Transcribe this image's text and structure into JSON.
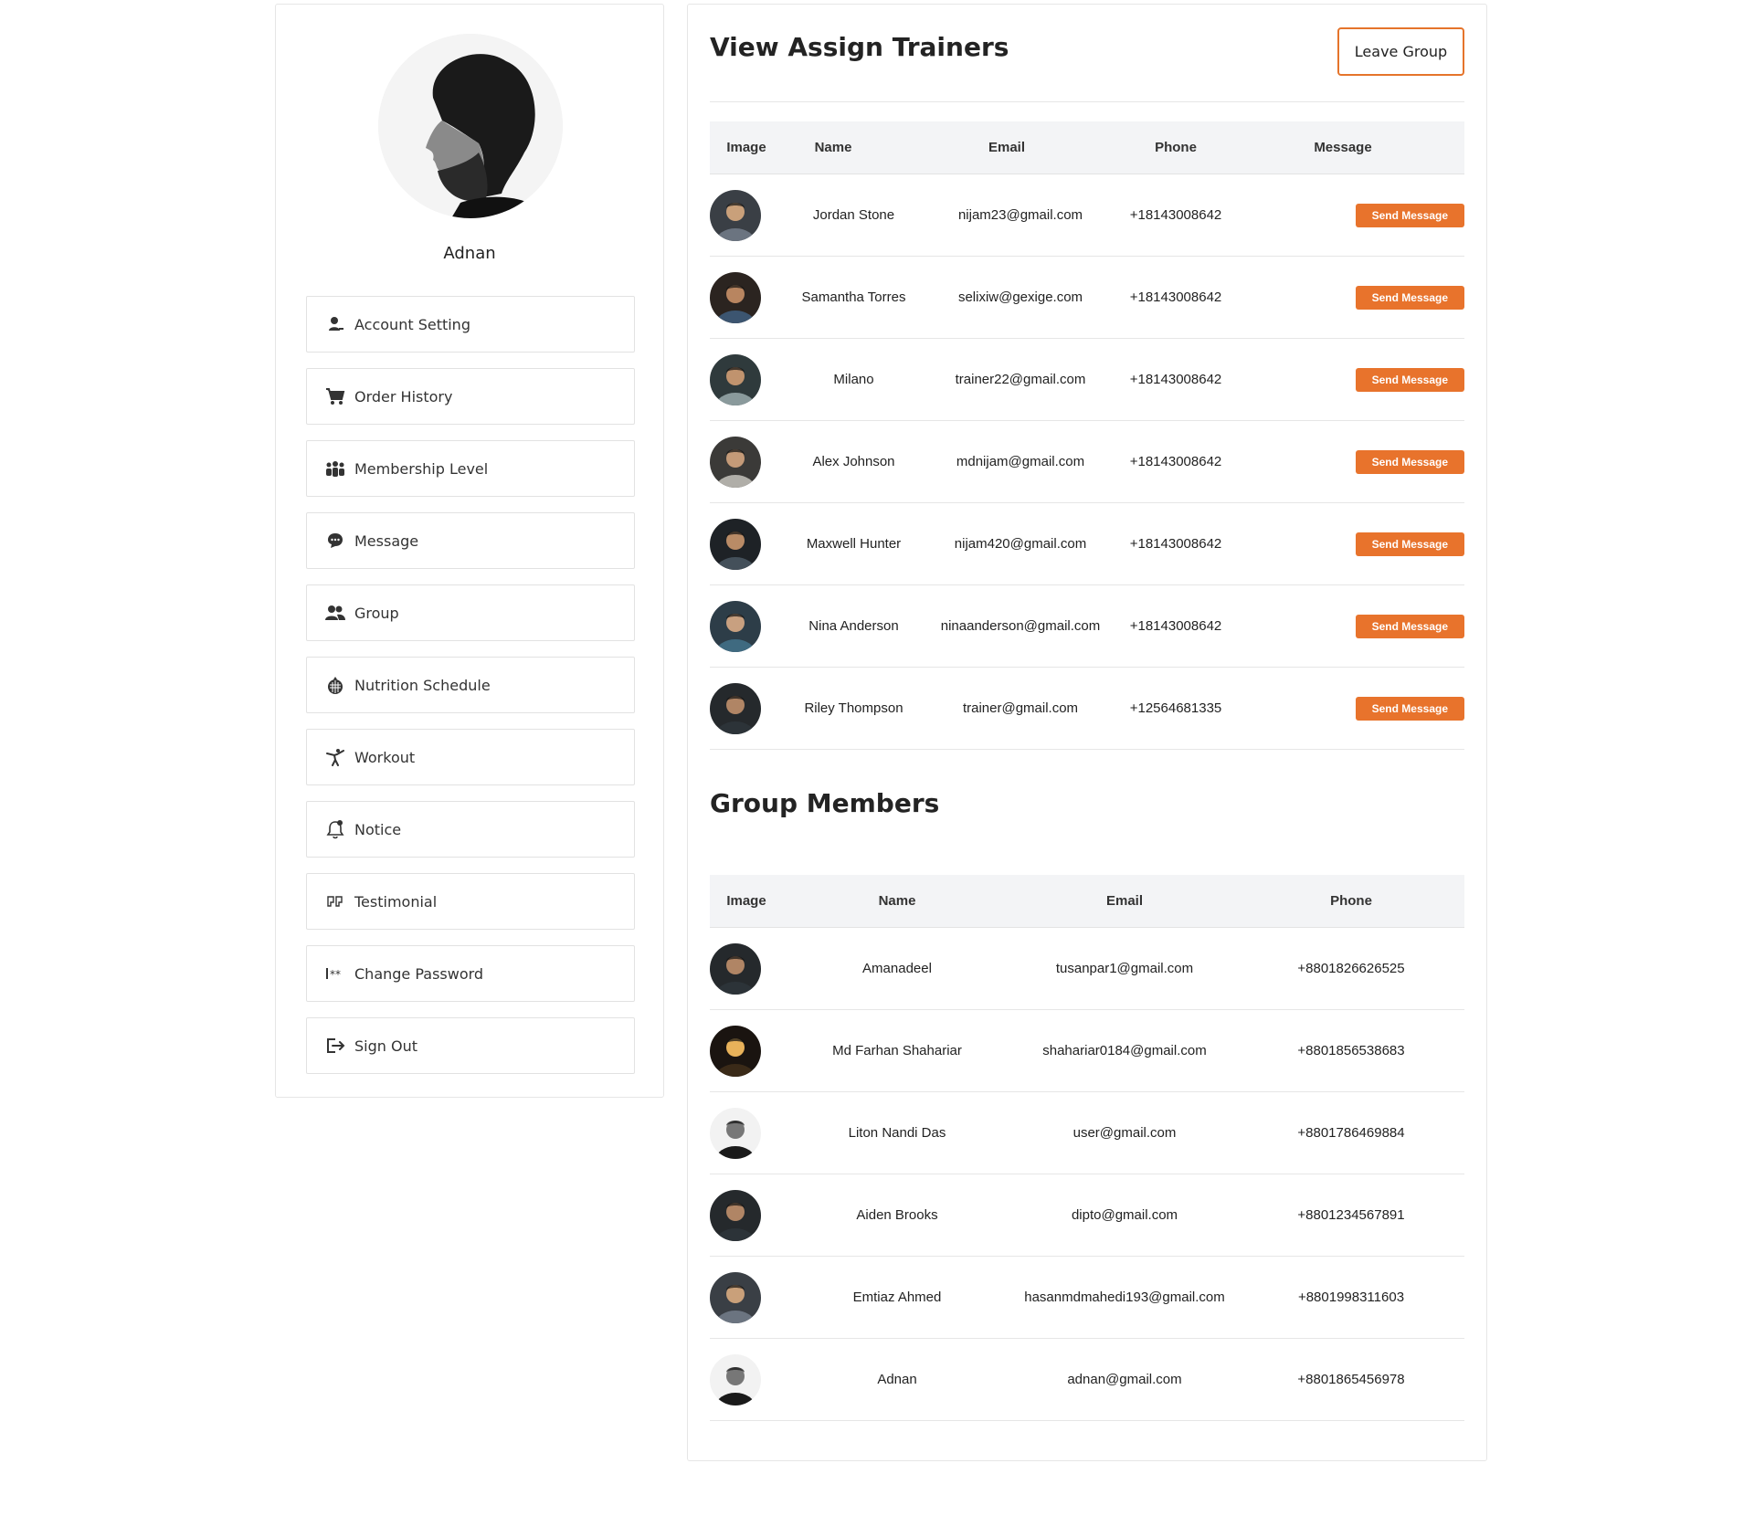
{
  "profile": {
    "name": "Adnan"
  },
  "sidebar": {
    "items": [
      {
        "label": "Account Setting",
        "icon": "user-icon"
      },
      {
        "label": "Order History",
        "icon": "cart-icon"
      },
      {
        "label": "Membership Level",
        "icon": "users-group-icon"
      },
      {
        "label": "Message",
        "icon": "chat-icon"
      },
      {
        "label": "Group",
        "icon": "group-icon"
      },
      {
        "label": "Nutrition Schedule",
        "icon": "nutrition-icon"
      },
      {
        "label": "Workout",
        "icon": "workout-icon"
      },
      {
        "label": "Notice",
        "icon": "bell-icon"
      },
      {
        "label": "Testimonial",
        "icon": "quote-icon"
      },
      {
        "label": "Change Password",
        "icon": "password-icon"
      },
      {
        "label": "Sign Out",
        "icon": "sign-out-icon"
      }
    ]
  },
  "trainers": {
    "title": "View Assign Trainers",
    "leave_label": "Leave Group",
    "columns": [
      "Image",
      "Name",
      "Email",
      "Phone",
      "Message"
    ],
    "send_label": "Send Message",
    "rows": [
      {
        "name": "Jordan Stone",
        "email": "nijam23@gmail.com",
        "phone": "+18143008642"
      },
      {
        "name": "Samantha Torres",
        "email": "selixiw@gexige.com",
        "phone": "+18143008642"
      },
      {
        "name": "Milano",
        "email": "trainer22@gmail.com",
        "phone": "+18143008642"
      },
      {
        "name": "Alex Johnson",
        "email": "mdnijam@gmail.com",
        "phone": "+18143008642"
      },
      {
        "name": "Maxwell Hunter",
        "email": "nijam420@gmail.com",
        "phone": "+18143008642"
      },
      {
        "name": "Nina Anderson",
        "email": "ninaanderson@gmail.com",
        "phone": "+18143008642"
      },
      {
        "name": "Riley Thompson",
        "email": "trainer@gmail.com",
        "phone": "+12564681335"
      }
    ]
  },
  "members": {
    "title": "Group Members",
    "columns": [
      "Image",
      "Name",
      "Email",
      "Phone"
    ],
    "rows": [
      {
        "name": "Amanadeel",
        "email": "tusanpar1@gmail.com",
        "phone": "+8801826626525"
      },
      {
        "name": "Md Farhan Shahariar",
        "email": "shahariar0184@gmail.com",
        "phone": "+8801856538683"
      },
      {
        "name": "Liton Nandi Das",
        "email": "user@gmail.com",
        "phone": "+8801786469884"
      },
      {
        "name": "Aiden Brooks",
        "email": "dipto@gmail.com",
        "phone": "+8801234567891"
      },
      {
        "name": "Emtiaz Ahmed",
        "email": "hasanmdmahedi193@gmail.com",
        "phone": "+8801998311603"
      },
      {
        "name": "Adnan",
        "email": "adnan@gmail.com",
        "phone": "+8801865456978"
      }
    ]
  },
  "colors": {
    "accent": "#e8732c",
    "header_bg": "#f3f4f6",
    "border": "#e6e6e6"
  }
}
